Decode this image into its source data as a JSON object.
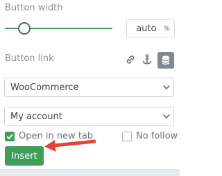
{
  "button_width": {
    "label": "Button width",
    "slider_fraction": 0.14,
    "value": "auto",
    "unit": "%"
  },
  "button_link": {
    "label": "Button link",
    "icons": [
      "link-icon",
      "anchor-icon",
      "database-icon"
    ],
    "source_select": {
      "value": "WooCommerce"
    },
    "page_select": {
      "value": "My account"
    }
  },
  "options": {
    "open_new_tab": {
      "label": "Open in new tab",
      "checked": true
    },
    "no_follow": {
      "label": "No follow",
      "checked": false
    }
  },
  "insert_label": "Insert",
  "colors": {
    "accent": "#3f9f5a",
    "arrow": "#e0453a",
    "active_icon_bg": "#7f8893"
  }
}
